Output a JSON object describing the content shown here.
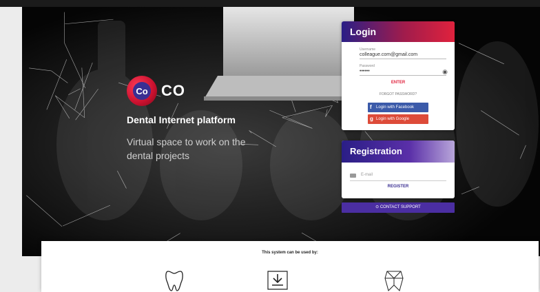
{
  "brand": {
    "name": "CO",
    "logo_letter": "Co"
  },
  "hero": {
    "tagline": "Dental Internet platform",
    "subtitle": "Virtual space to work on the dental projects"
  },
  "login": {
    "title": "Login",
    "username_label": "Username",
    "username_value": "colleague.com@gmail.com",
    "password_label": "Password",
    "password_value": "••••••",
    "enter_label": "ENTER",
    "forgot_label": "FORGOT PASSWORD?",
    "facebook_label": "Login with Facebook",
    "google_label": "Login with Google",
    "eye_icon": "eye-icon"
  },
  "registration": {
    "title": "Registration",
    "email_placeholder": "E-mail",
    "register_label": "REGISTER"
  },
  "support": {
    "label": "CONTACT SUPPORT",
    "icon": "support-icon"
  },
  "usage": {
    "title": "This system can be used by:",
    "icons": [
      "tooth-icon",
      "dental-tool-icon",
      "mesh-tooth-icon"
    ]
  },
  "colors": {
    "accent_red": "#e0223d",
    "accent_purple": "#3a2f92",
    "facebook": "#3b5aa9",
    "google": "#dd4b39"
  }
}
